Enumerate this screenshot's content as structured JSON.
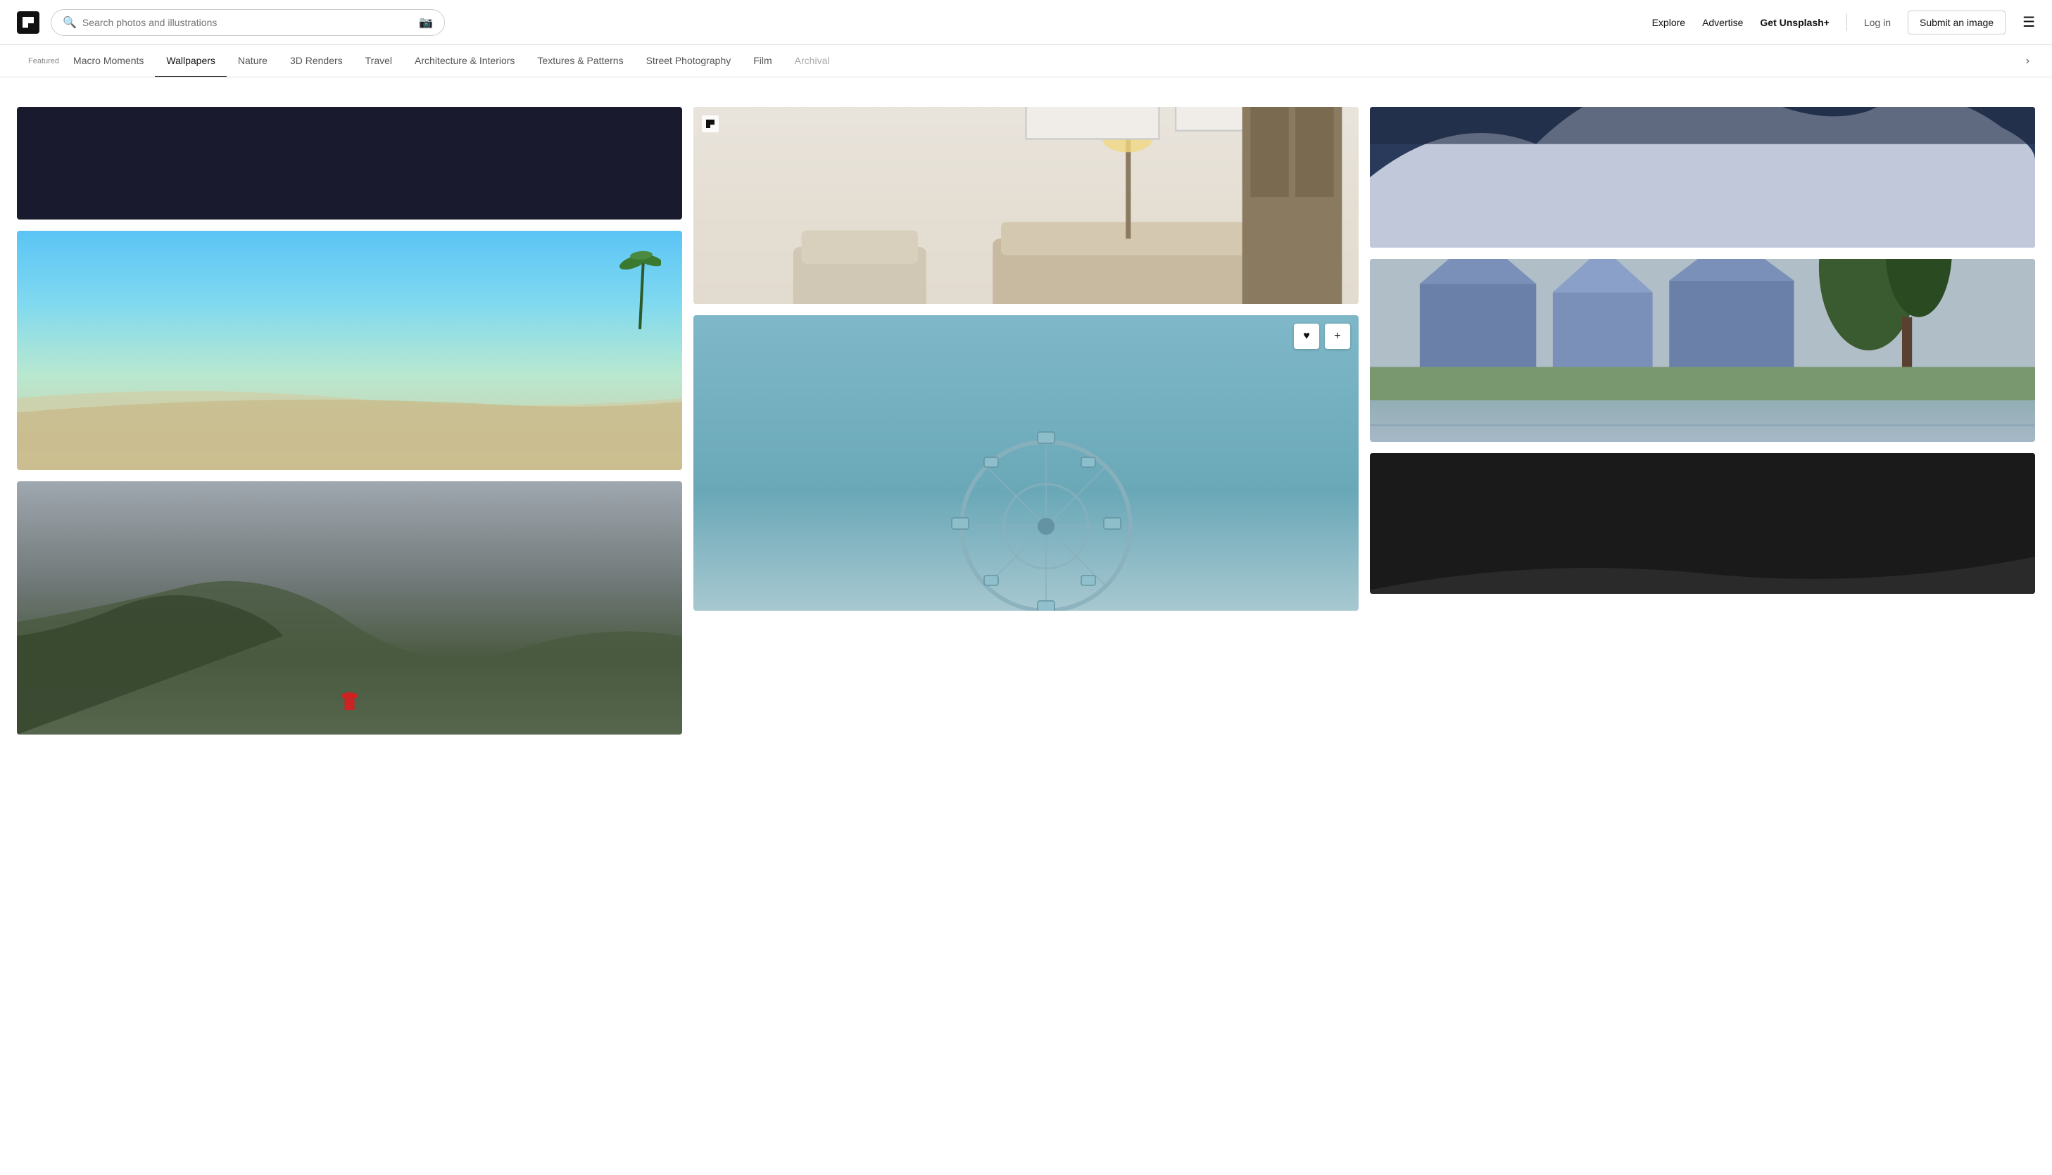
{
  "header": {
    "logo_alt": "Unsplash logo",
    "search_placeholder": "Search photos and illustrations",
    "nav": {
      "explore": "Explore",
      "advertise": "Advertise",
      "get_plus": "Get Unsplash+",
      "login": "Log in",
      "submit": "Submit an image"
    }
  },
  "tabs": {
    "featured_label": "Featured",
    "items": [
      {
        "id": "macro-moments",
        "label": "Macro Moments",
        "active": false
      },
      {
        "id": "wallpapers",
        "label": "Wallpapers",
        "active": true
      },
      {
        "id": "nature",
        "label": "Nature",
        "active": false
      },
      {
        "id": "3d-renders",
        "label": "3D Renders",
        "active": false
      },
      {
        "id": "travel",
        "label": "Travel",
        "active": false
      },
      {
        "id": "architecture",
        "label": "Architecture & Interiors",
        "active": false
      },
      {
        "id": "textures",
        "label": "Textures & Patterns",
        "active": false
      },
      {
        "id": "street",
        "label": "Street Photography",
        "active": false
      },
      {
        "id": "film",
        "label": "Film",
        "active": false
      },
      {
        "id": "archival",
        "label": "Archival",
        "active": false
      }
    ]
  },
  "photos": {
    "col1": [
      {
        "id": "dark-top",
        "type": "dark-top",
        "alt": "Dark abstract photo"
      },
      {
        "id": "beach",
        "type": "beach",
        "alt": "Tropical beach with clear water"
      },
      {
        "id": "mountain",
        "type": "mountain",
        "alt": "Person standing by dramatic mountain landscape"
      }
    ],
    "col2": [
      {
        "id": "room",
        "type": "room",
        "alt": "Minimalist living room interior",
        "has_logo": true
      },
      {
        "id": "ferris",
        "type": "ferris",
        "alt": "Ferris wheel against blue sky",
        "has_actions": true
      }
    ],
    "col3": [
      {
        "id": "snowy",
        "type": "snowy",
        "alt": "Snow covered mountains"
      },
      {
        "id": "houses",
        "type": "houses",
        "alt": "Houses reflected in water"
      },
      {
        "id": "dark-bottom",
        "type": "dark-bottom",
        "alt": "Dark landscape"
      }
    ]
  },
  "actions": {
    "like": "♥",
    "add": "+"
  }
}
